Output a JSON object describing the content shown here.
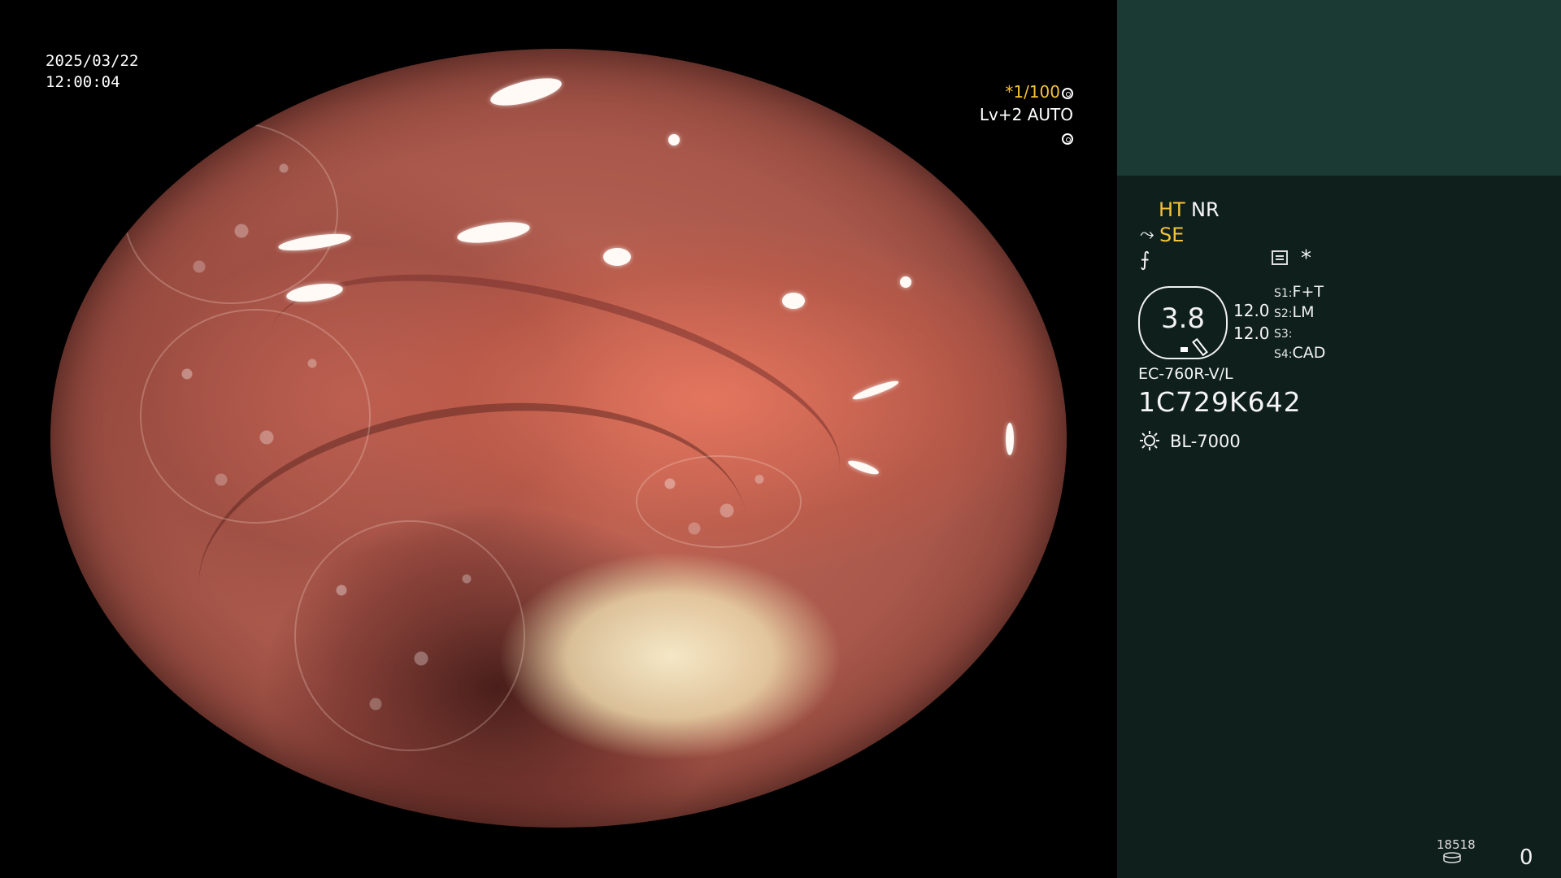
{
  "overlay": {
    "date": "2025/03/22",
    "time": "12:00:04",
    "shutter": "*1/100",
    "shutter_icon": "aperture-icon",
    "level": "Lv+2 AUTO",
    "level_icon": "target-icon"
  },
  "panel": {
    "mode_ht": "HT",
    "mode_nr": "NR",
    "mode_se": "SE",
    "se_icon": "lightning-curve-icon",
    "curve_icon": "slash-curve-icon",
    "list_icon": "list-icon",
    "star": "*",
    "octagon_value": "3.8",
    "value_1": "12.0",
    "value_2": "12.0",
    "slots": [
      {
        "key": "S1:",
        "value": "F+T"
      },
      {
        "key": "S2:",
        "value": "LM"
      },
      {
        "key": "S3:",
        "value": ""
      },
      {
        "key": "S4:",
        "value": "CAD"
      }
    ],
    "model": "EC-760R-V/L",
    "serial": "1C729K642",
    "light_icon": "sun-icon",
    "light_source": "BL-7000",
    "storage_counter": "18518",
    "storage_icon": "disk-icon",
    "frame_count": "0"
  },
  "colors": {
    "accent_yellow": "#f5c238",
    "panel_bg": "#0e1f1c",
    "panel_top_bg": "#1b3a34"
  }
}
